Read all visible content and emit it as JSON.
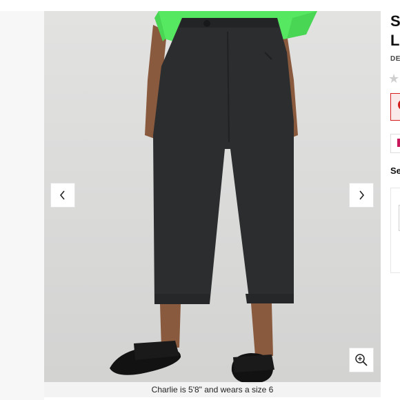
{
  "gallery": {
    "caption": "Charlie is 5'8\" and wears a size 6",
    "prev_icon": "chevron-left-icon",
    "next_icon": "chevron-right-icon",
    "zoom_icon": "zoom-in-icon"
  },
  "product": {
    "title_line1": "S",
    "title_line2": "L",
    "subtitle": "DE",
    "rating_icon": "star-icon",
    "section_heading": "Se"
  },
  "colors": {
    "background": "#d9d9d8",
    "pants": "#2c2d2f",
    "top": "#57e861",
    "sandals": "#121212",
    "promo": "#d31c1c",
    "pay_brand": "#c9175c"
  }
}
